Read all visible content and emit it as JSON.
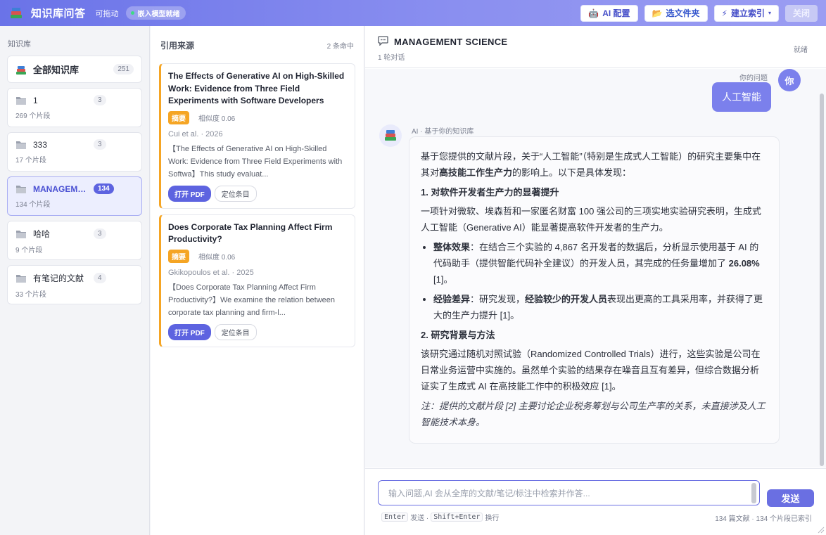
{
  "header": {
    "title": "知识库问答",
    "drag_hint": "可拖动",
    "model_status": "嵌入模型就绪",
    "buttons": {
      "ai_config": "AI 配置",
      "choose_folder": "选文件夹",
      "build_index": "建立索引",
      "close": "关闭"
    },
    "colors": {
      "gradient_start": "#6a73e8",
      "gradient_end": "#9b9df2"
    }
  },
  "knowledge_base": {
    "title": "知识库",
    "items": [
      {
        "name": "全部知识库",
        "count": "251",
        "sub": ""
      },
      {
        "name": "1",
        "count": "3",
        "sub": "269 个片段"
      },
      {
        "name": "333",
        "count": "3",
        "sub": "17 个片段"
      },
      {
        "name": "MANAGEME...",
        "count": "134",
        "sub": "134 个片段",
        "active": true
      },
      {
        "name": "哈哈",
        "count": "3",
        "sub": "9 个片段"
      },
      {
        "name": "有笔记的文献",
        "count": "4",
        "sub": "33 个片段"
      }
    ]
  },
  "sources": {
    "title": "引用来源",
    "hits": "2 条命中",
    "items": [
      {
        "title": "The Effects of Generative AI on High-Skilled Work: Evidence from Three Field Experiments with Software Developers",
        "badge": "摘要",
        "similarity": "相似度 0.06",
        "author": "Cui et al. · 2026",
        "excerpt": "【The Effects of Generative AI on High-Skilled Work: Evidence from Three Field Experiments with Softwa】This study evaluat...",
        "open_pdf": "打开 PDF",
        "locate": "定位条目"
      },
      {
        "title": "Does Corporate Tax Planning Affect Firm Productivity?",
        "badge": "摘要",
        "similarity": "相似度 0.06",
        "author": "Gkikopoulos et al. · 2025",
        "excerpt": "【Does Corporate Tax Planning Affect Firm Productivity?】We examine the relation between corporate tax planning and firm-l...",
        "open_pdf": "打开 PDF",
        "locate": "定位条目"
      }
    ]
  },
  "chat": {
    "title": "MANAGEMENT SCIENCE",
    "rounds": "1 轮对话",
    "state": "就绪",
    "user_label": "你的问题",
    "user_avatar": "你",
    "user_message": "人工智能",
    "ai_label": "AI · 基于你的知识库",
    "answer": {
      "intro_a": "基于您提供的文献片段，关于“人工智能”（特别是生成式人工智能）的研究主要集中在其对",
      "intro_b": "高技能工作生产力",
      "intro_c": "的影响上。以下是具体发现：",
      "h1": "1. 对软件开发者生产力的显著提升",
      "p1": "一项针对微软、埃森哲和一家匿名财富 100 强公司的三项实地实验研究表明，生成式人工智能（Generative AI）能显著提高软件开发者的生产力。",
      "b1_label": "整体效果",
      "b1_text": "：在结合三个实验的 4,867 名开发者的数据后，分析显示使用基于 AI 的代码助手（提供智能代码补全建议）的开发人员，其完成的任务量增加了 ",
      "b1_value": "26.08%",
      "b1_ref": " [1]。",
      "b2_label": "经验差异",
      "b2_text_a": "：研究发现，",
      "b2_bold": "经验较少的开发人员",
      "b2_text_b": "表现出更高的工具采用率，并获得了更大的生产力提升 [1]。",
      "h2": "2. 研究背景与方法",
      "p2": "该研究通过随机对照试验（Randomized Controlled Trials）进行，这些实验是公司在日常业务运营中实施的。虽然单个实验的结果存在噪音且互有差异，但综合数据分析证实了生成式 AI 在高技能工作中的积极效应 [1]。",
      "note": "注：提供的文献片段 [2] 主要讨论企业税务筹划与公司生产率的关系，未直接涉及人工智能技术本身。"
    },
    "input_placeholder": "输入问题,AI 会从全库的文献/笔记/标注中检索并作答...",
    "send": "发送",
    "hint_enter": "Enter",
    "hint_send": "发送 ·",
    "hint_shift": "Shift+Enter",
    "hint_newline": "换行",
    "totals": "134 篇文献 · 134 个片段已索引"
  }
}
